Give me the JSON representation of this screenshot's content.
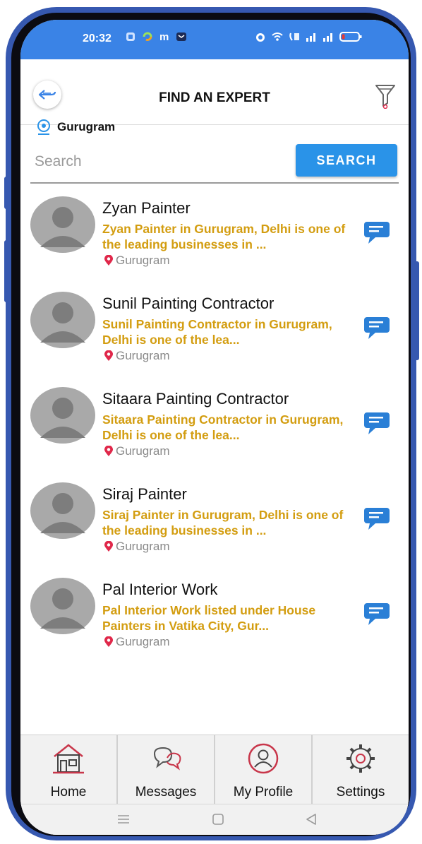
{
  "status_bar": {
    "time": "20:32"
  },
  "header": {
    "title": "FIND AN EXPERT"
  },
  "location": {
    "name": "Gurugram"
  },
  "search": {
    "placeholder": "Search",
    "value": "",
    "button_label": "SEARCH"
  },
  "experts": [
    {
      "name": "Zyan Painter",
      "desc": "Zyan Painter in Gurugram, Delhi is one of the leading businesses in ...",
      "location": "Gurugram"
    },
    {
      "name": "Sunil Painting Contractor",
      "desc": "Sunil Painting Contractor in Gurugram, Delhi is one of the lea...",
      "location": "Gurugram"
    },
    {
      "name": "Sitaara Painting Contractor",
      "desc": "Sitaara Painting Contractor in Gurugram, Delhi is one of the lea...",
      "location": "Gurugram"
    },
    {
      "name": "Siraj Painter",
      "desc": "Siraj Painter in Gurugram, Delhi is one of the leading businesses in ...",
      "location": "Gurugram"
    },
    {
      "name": "Pal Interior Work",
      "desc": "Pal Interior Work listed under House Painters in Vatika City, Gur...",
      "location": "Gurugram"
    }
  ],
  "bottom_nav": [
    {
      "label": "Home",
      "icon": "home-icon"
    },
    {
      "label": "Messages",
      "icon": "chat-bubbles-icon"
    },
    {
      "label": "My Profile",
      "icon": "profile-icon"
    },
    {
      "label": "Settings",
      "icon": "gear-icon"
    }
  ],
  "colors": {
    "status_bar": "#3a83e6",
    "search_button": "#2a93e8",
    "description": "#d39d10",
    "location_pin": "#e0284a",
    "chat_icon": "#2a7fd6",
    "nav_icons": "#c8364a",
    "frame": "#3658b0"
  }
}
